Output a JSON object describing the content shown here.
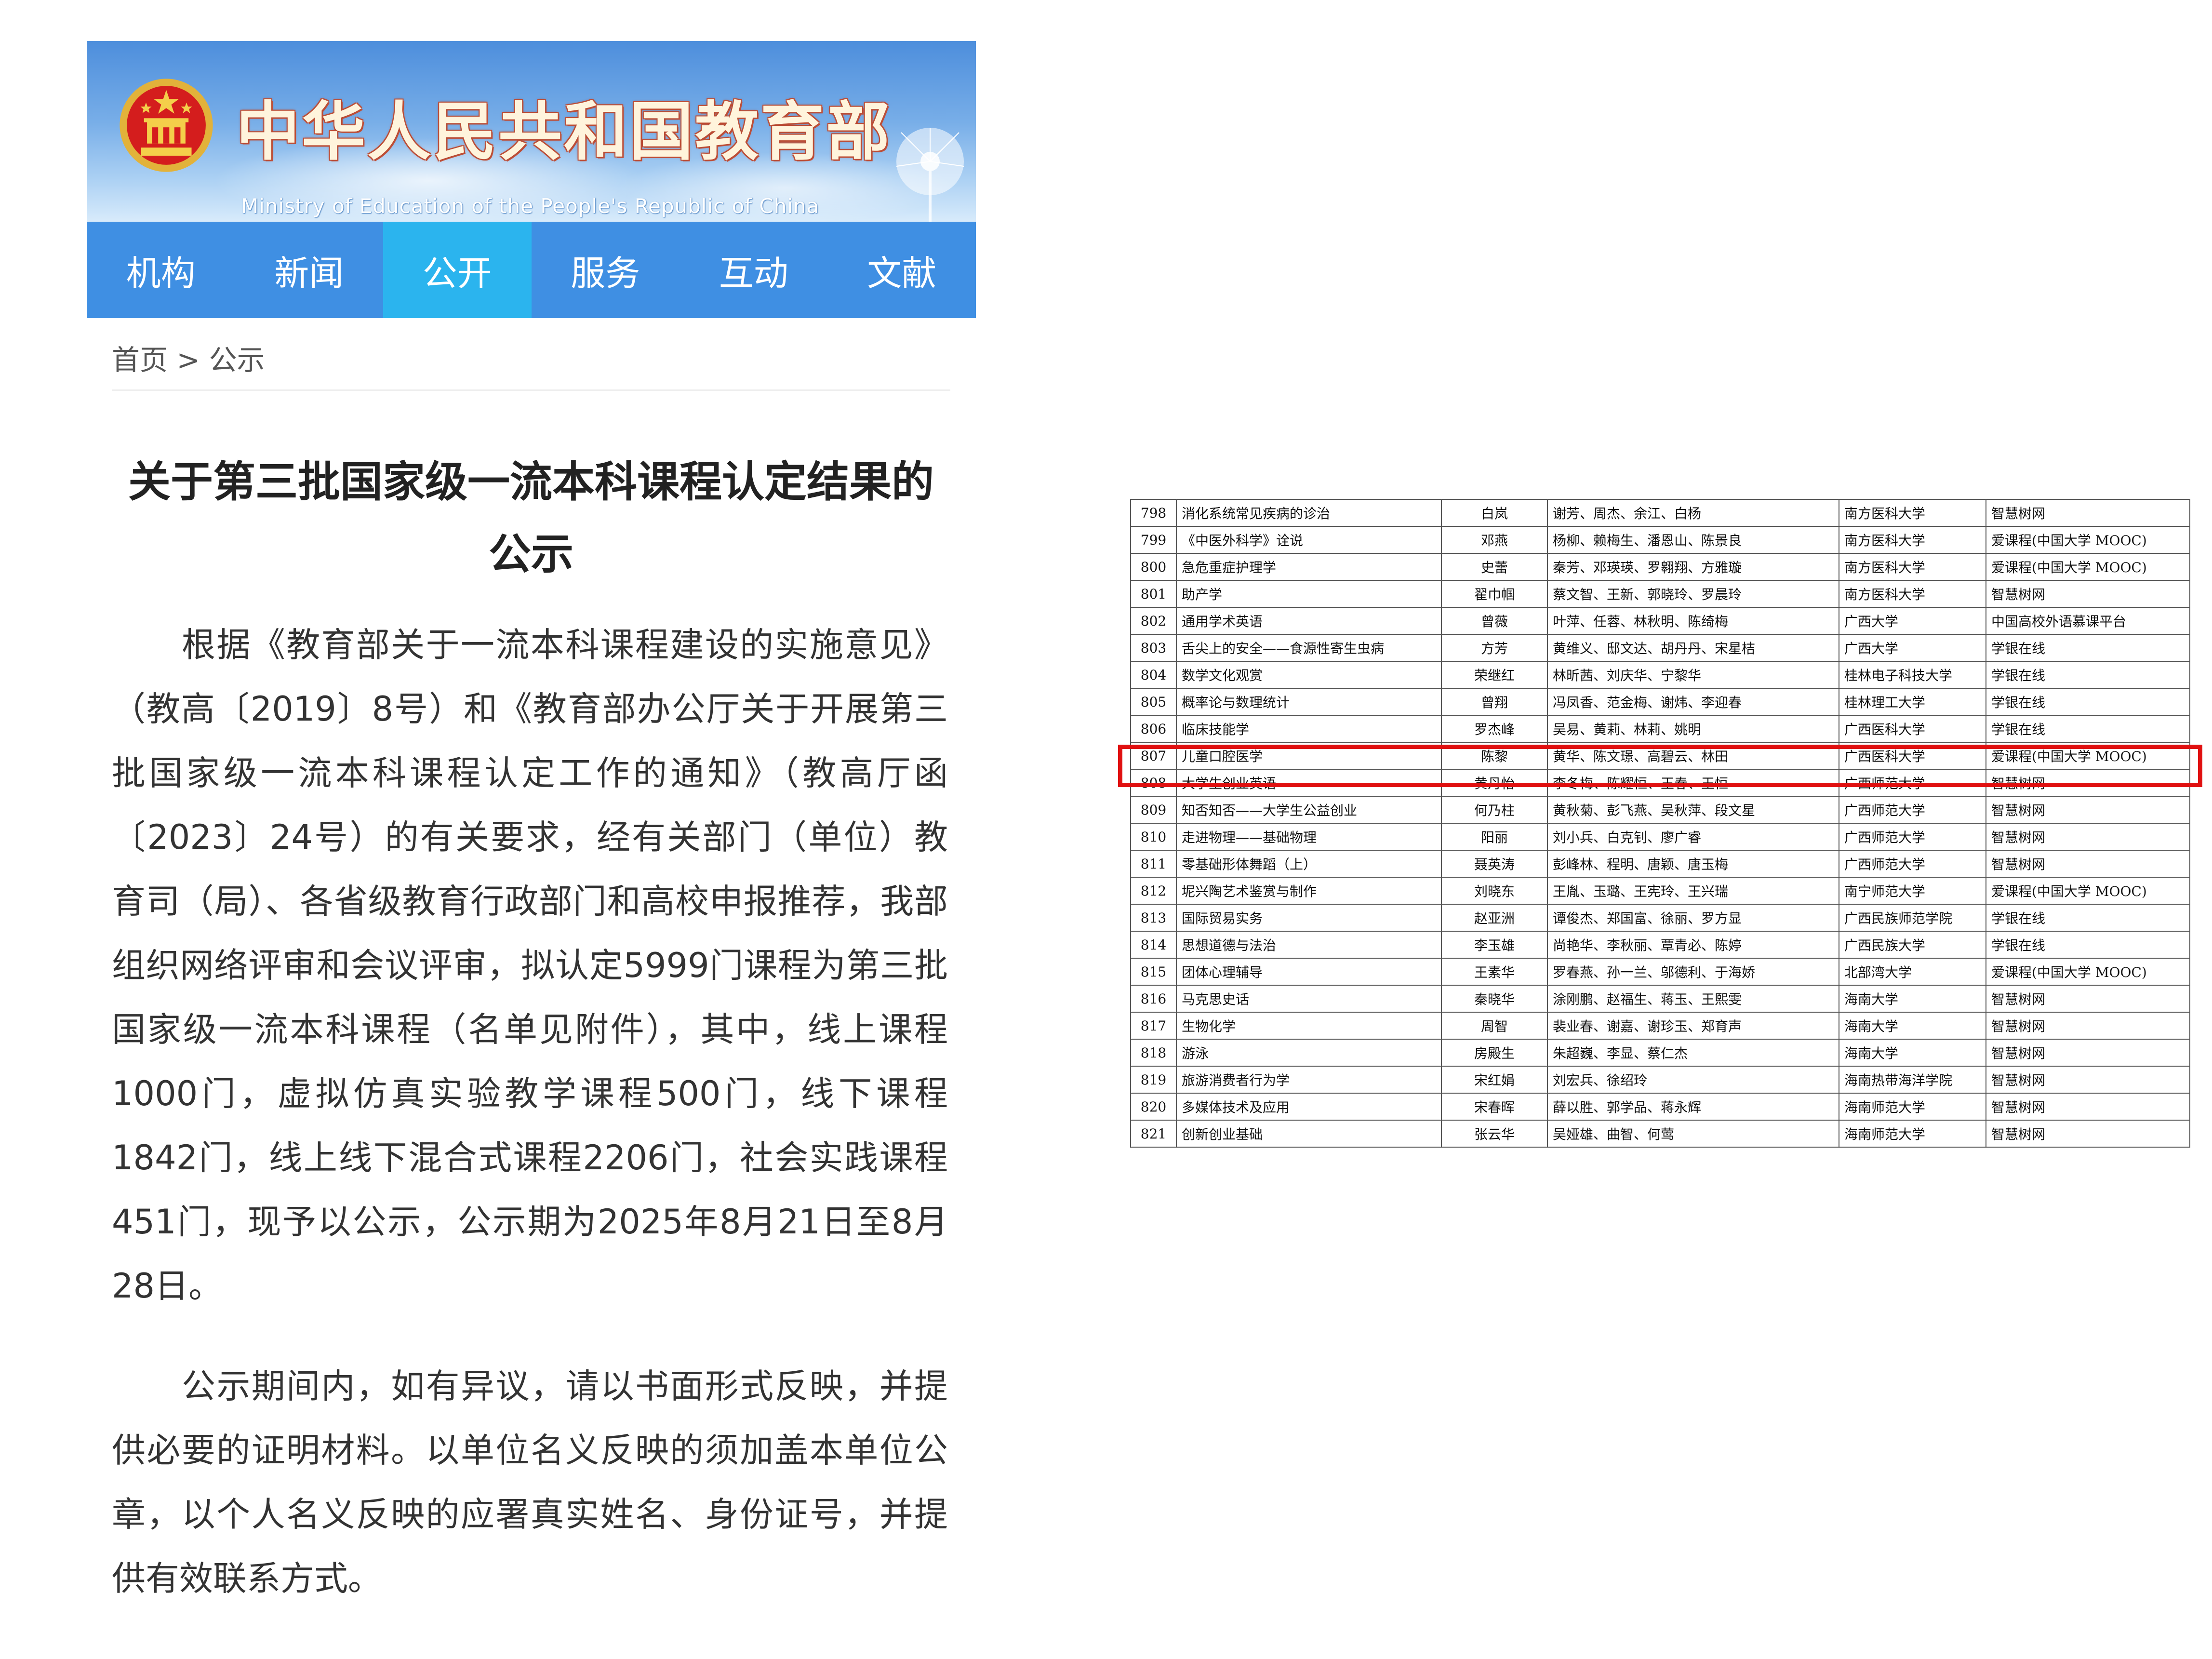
{
  "header": {
    "title": "中华人民共和国教育部",
    "subtitle": "Ministry of Education of the People's Republic of China"
  },
  "nav": {
    "tabs": [
      {
        "label": "机构"
      },
      {
        "label": "新闻"
      },
      {
        "label": "公开",
        "active": true
      },
      {
        "label": "服务"
      },
      {
        "label": "互动"
      },
      {
        "label": "文献"
      }
    ]
  },
  "breadcrumb": {
    "home": "首页",
    "separator": " > ",
    "current": "公示"
  },
  "article": {
    "title": "关于第三批国家级一流本科课程认定结果的公示",
    "paragraphs": [
      "根据《教育部关于一流本科课程建设的实施意见》（教高〔2019〕8号）和《教育部办公厅关于开展第三批国家级一流本科课程认定工作的通知》（教高厅函〔2023〕24号）的有关要求，经有关部门（单位）教育司（局）、各省级教育行政部门和高校申报推荐，我部组织网络评审和会议评审，拟认定5999门课程为第三批国家级一流本科课程（名单见附件），其中，线上课程1000门，虚拟仿真实验教学课程500门，线下课程1842门，线上线下混合式课程2206门，社会实践课程451门，现予以公示，公示期为2025年8月21日至8月28日。",
      "公示期间内，如有异议，请以书面形式反映，并提供必要的证明材料。以单位名义反映的须加盖本单位公章，以个人名义反映的应署真实姓名、身份证号，并提供有效联系方式。"
    ]
  },
  "table": {
    "highlight_color": "#e01010",
    "highlighted_row": "807",
    "rows": [
      [
        "798",
        "消化系统常见疾病的诊治",
        "白岚",
        "谢芳、周杰、余江、白杨",
        "南方医科大学",
        "智慧树网"
      ],
      [
        "799",
        "《中医外科学》诠说",
        "邓燕",
        "杨柳、赖梅生、潘恩山、陈景良",
        "南方医科大学",
        "爱课程(中国大学 MOOC)"
      ],
      [
        "800",
        "急危重症护理学",
        "史蕾",
        "秦芳、邓瑛瑛、罗翱翔、方雅璇",
        "南方医科大学",
        "爱课程(中国大学 MOOC)"
      ],
      [
        "801",
        "助产学",
        "翟巾帼",
        "蔡文智、王新、郭晓玲、罗晨玲",
        "南方医科大学",
        "智慧树网"
      ],
      [
        "802",
        "通用学术英语",
        "曾薇",
        "叶萍、任蓉、林秋明、陈绮梅",
        "广西大学",
        "中国高校外语慕课平台"
      ],
      [
        "803",
        "舌尖上的安全——食源性寄生虫病",
        "方芳",
        "黄维义、邸文达、胡丹丹、宋星桔",
        "广西大学",
        "学银在线"
      ],
      [
        "804",
        "数学文化观赏",
        "荣继红",
        "林昕茜、刘庆华、宁黎华",
        "桂林电子科技大学",
        "学银在线"
      ],
      [
        "805",
        "概率论与数理统计",
        "曾翔",
        "冯凤香、范金梅、谢炜、李迎春",
        "桂林理工大学",
        "学银在线"
      ],
      [
        "806",
        "临床技能学",
        "罗杰峰",
        "吴易、黄莉、林莉、姚明",
        "广西医科大学",
        "学银在线"
      ],
      [
        "807",
        "儿童口腔医学",
        "陈黎",
        "黄华、陈文璟、高碧云、林田",
        "广西医科大学",
        "爱课程(中国大学 MOOC)"
      ],
      [
        "808",
        "大学生创业英语",
        "黄丹怡",
        "李冬梅、陈耀恒、王春、王恒",
        "广西师范大学",
        "智慧树网"
      ],
      [
        "809",
        "知否知否——大学生公益创业",
        "何乃柱",
        "黄秋菊、彭飞燕、吴秋萍、段文星",
        "广西师范大学",
        "智慧树网"
      ],
      [
        "810",
        "走进物理——基础物理",
        "阳丽",
        "刘小兵、白克钊、廖广睿",
        "广西师范大学",
        "智慧树网"
      ],
      [
        "811",
        "零基础形体舞蹈（上）",
        "聂英涛",
        "彭峰林、程明、唐颖、唐玉梅",
        "广西师范大学",
        "智慧树网"
      ],
      [
        "812",
        "坭兴陶艺术鉴赏与制作",
        "刘晓东",
        "王胤、玉璐、王宪玲、王兴瑞",
        "南宁师范大学",
        "爱课程(中国大学 MOOC)"
      ],
      [
        "813",
        "国际贸易实务",
        "赵亚洲",
        "谭俊杰、郑国富、徐丽、罗方显",
        "广西民族师范学院",
        "学银在线"
      ],
      [
        "814",
        "思想道德与法治",
        "李玉雄",
        "尚艳华、李秋丽、覃青必、陈婷",
        "广西民族大学",
        "学银在线"
      ],
      [
        "815",
        "团体心理辅导",
        "王素华",
        "罗春燕、孙一兰、邬德利、于海娇",
        "北部湾大学",
        "爱课程(中国大学 MOOC)"
      ],
      [
        "816",
        "马克思史话",
        "秦晓华",
        "涂刚鹏、赵福生、蒋玉、王熙雯",
        "海南大学",
        "智慧树网"
      ],
      [
        "817",
        "生物化学",
        "周智",
        "裴业春、谢嘉、谢珍玉、郑育声",
        "海南大学",
        "智慧树网"
      ],
      [
        "818",
        "游泳",
        "房殿生",
        "朱超巍、李显、蔡仁杰",
        "海南大学",
        "智慧树网"
      ],
      [
        "819",
        "旅游消费者行为学",
        "宋红娟",
        "刘宏兵、徐绍玲",
        "海南热带海洋学院",
        "智慧树网"
      ],
      [
        "820",
        "多媒体技术及应用",
        "宋春晖",
        "薛以胜、郭学品、蒋永辉",
        "海南师范大学",
        "智慧树网"
      ],
      [
        "821",
        "创新创业基础",
        "张云华",
        "吴娅雄、曲智、何莺",
        "海南师范大学",
        "智慧树网"
      ]
    ]
  }
}
